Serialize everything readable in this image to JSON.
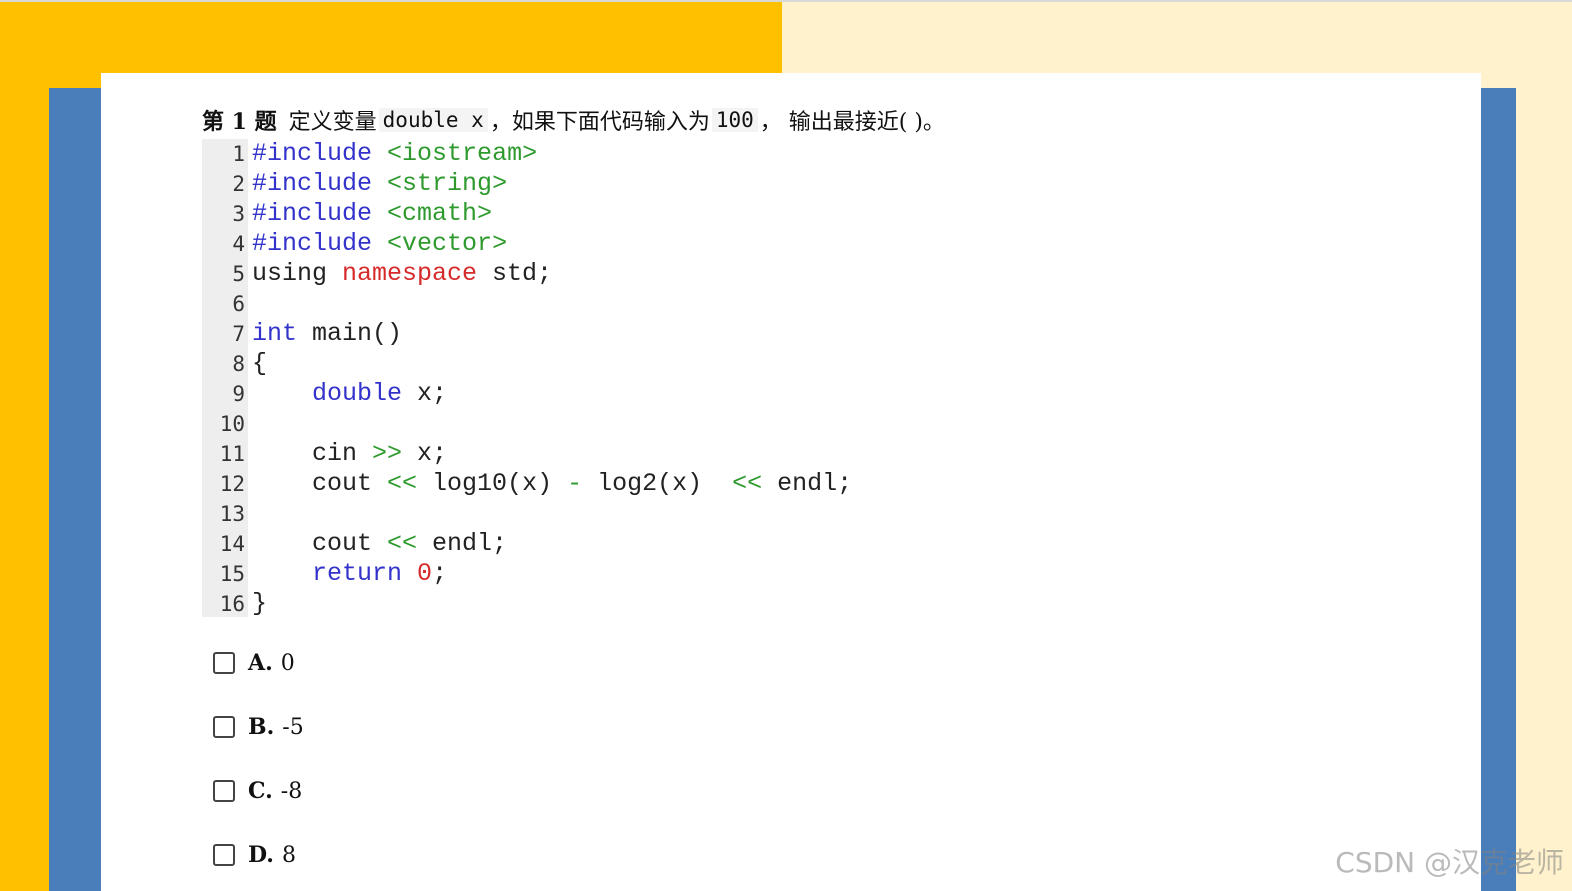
{
  "question": {
    "number": "第 1 题",
    "text_before": "定义变量",
    "var_decl": "double x",
    "text_middle": "，如果下面代码输入为",
    "input_value": "100",
    "text_after": "，  输出最接近(  )。"
  },
  "code": {
    "lines": [
      {
        "n": "1"
      },
      {
        "n": "2"
      },
      {
        "n": "3"
      },
      {
        "n": "4"
      },
      {
        "n": "5"
      },
      {
        "n": "6"
      },
      {
        "n": "7"
      },
      {
        "n": "8"
      },
      {
        "n": "9"
      },
      {
        "n": "10"
      },
      {
        "n": "11"
      },
      {
        "n": "12"
      },
      {
        "n": "13"
      },
      {
        "n": "14"
      },
      {
        "n": "15"
      },
      {
        "n": "16"
      }
    ],
    "tokens": {
      "l1": [
        {
          "t": "#include",
          "c": "pp"
        },
        {
          "t": " "
        },
        {
          "t": "<iostream>",
          "c": "inc"
        }
      ],
      "l2": [
        {
          "t": "#include",
          "c": "pp"
        },
        {
          "t": " "
        },
        {
          "t": "<string>",
          "c": "inc"
        }
      ],
      "l3": [
        {
          "t": "#include",
          "c": "pp"
        },
        {
          "t": " "
        },
        {
          "t": "<cmath>",
          "c": "inc"
        }
      ],
      "l4": [
        {
          "t": "#include",
          "c": "pp"
        },
        {
          "t": " "
        },
        {
          "t": "<vector>",
          "c": "inc"
        }
      ],
      "l5": [
        {
          "t": "using "
        },
        {
          "t": "namespace",
          "c": "ns"
        },
        {
          "t": " std;"
        }
      ],
      "l6": [],
      "l7": [
        {
          "t": "int",
          "c": "kw"
        },
        {
          "t": " main()"
        }
      ],
      "l8": [
        {
          "t": "{"
        }
      ],
      "l9": [
        {
          "t": "    "
        },
        {
          "t": "double",
          "c": "kw"
        },
        {
          "t": " x;"
        }
      ],
      "l10": [],
      "l11": [
        {
          "t": "    cin "
        },
        {
          "t": ">>",
          "c": "op"
        },
        {
          "t": " x;"
        }
      ],
      "l12": [
        {
          "t": "    cout "
        },
        {
          "t": "<<",
          "c": "op"
        },
        {
          "t": " log10(x) "
        },
        {
          "t": "-",
          "c": "op"
        },
        {
          "t": " log2(x)  "
        },
        {
          "t": "<<",
          "c": "op"
        },
        {
          "t": " endl;"
        }
      ],
      "l13": [],
      "l14": [
        {
          "t": "    cout "
        },
        {
          "t": "<<",
          "c": "op"
        },
        {
          "t": " endl;"
        }
      ],
      "l15": [
        {
          "t": "    "
        },
        {
          "t": "return",
          "c": "kw"
        },
        {
          "t": " "
        },
        {
          "t": "0",
          "c": "numl"
        },
        {
          "t": ";"
        }
      ],
      "l16": [
        {
          "t": "}"
        }
      ]
    }
  },
  "options": [
    {
      "letter": "A.",
      "value": "0"
    },
    {
      "letter": "B.",
      "value": "-5"
    },
    {
      "letter": "C.",
      "value": "-8"
    },
    {
      "letter": "D.",
      "value": "8"
    }
  ],
  "watermark": "CSDN @汉克老师",
  "colors": {
    "orange": "#FFC000",
    "cream": "#FFF2CC",
    "blue": "#4A7EBB",
    "keyword": "#3333cc",
    "include_path": "#2e9a2e",
    "namespace": "#d62a2a"
  }
}
